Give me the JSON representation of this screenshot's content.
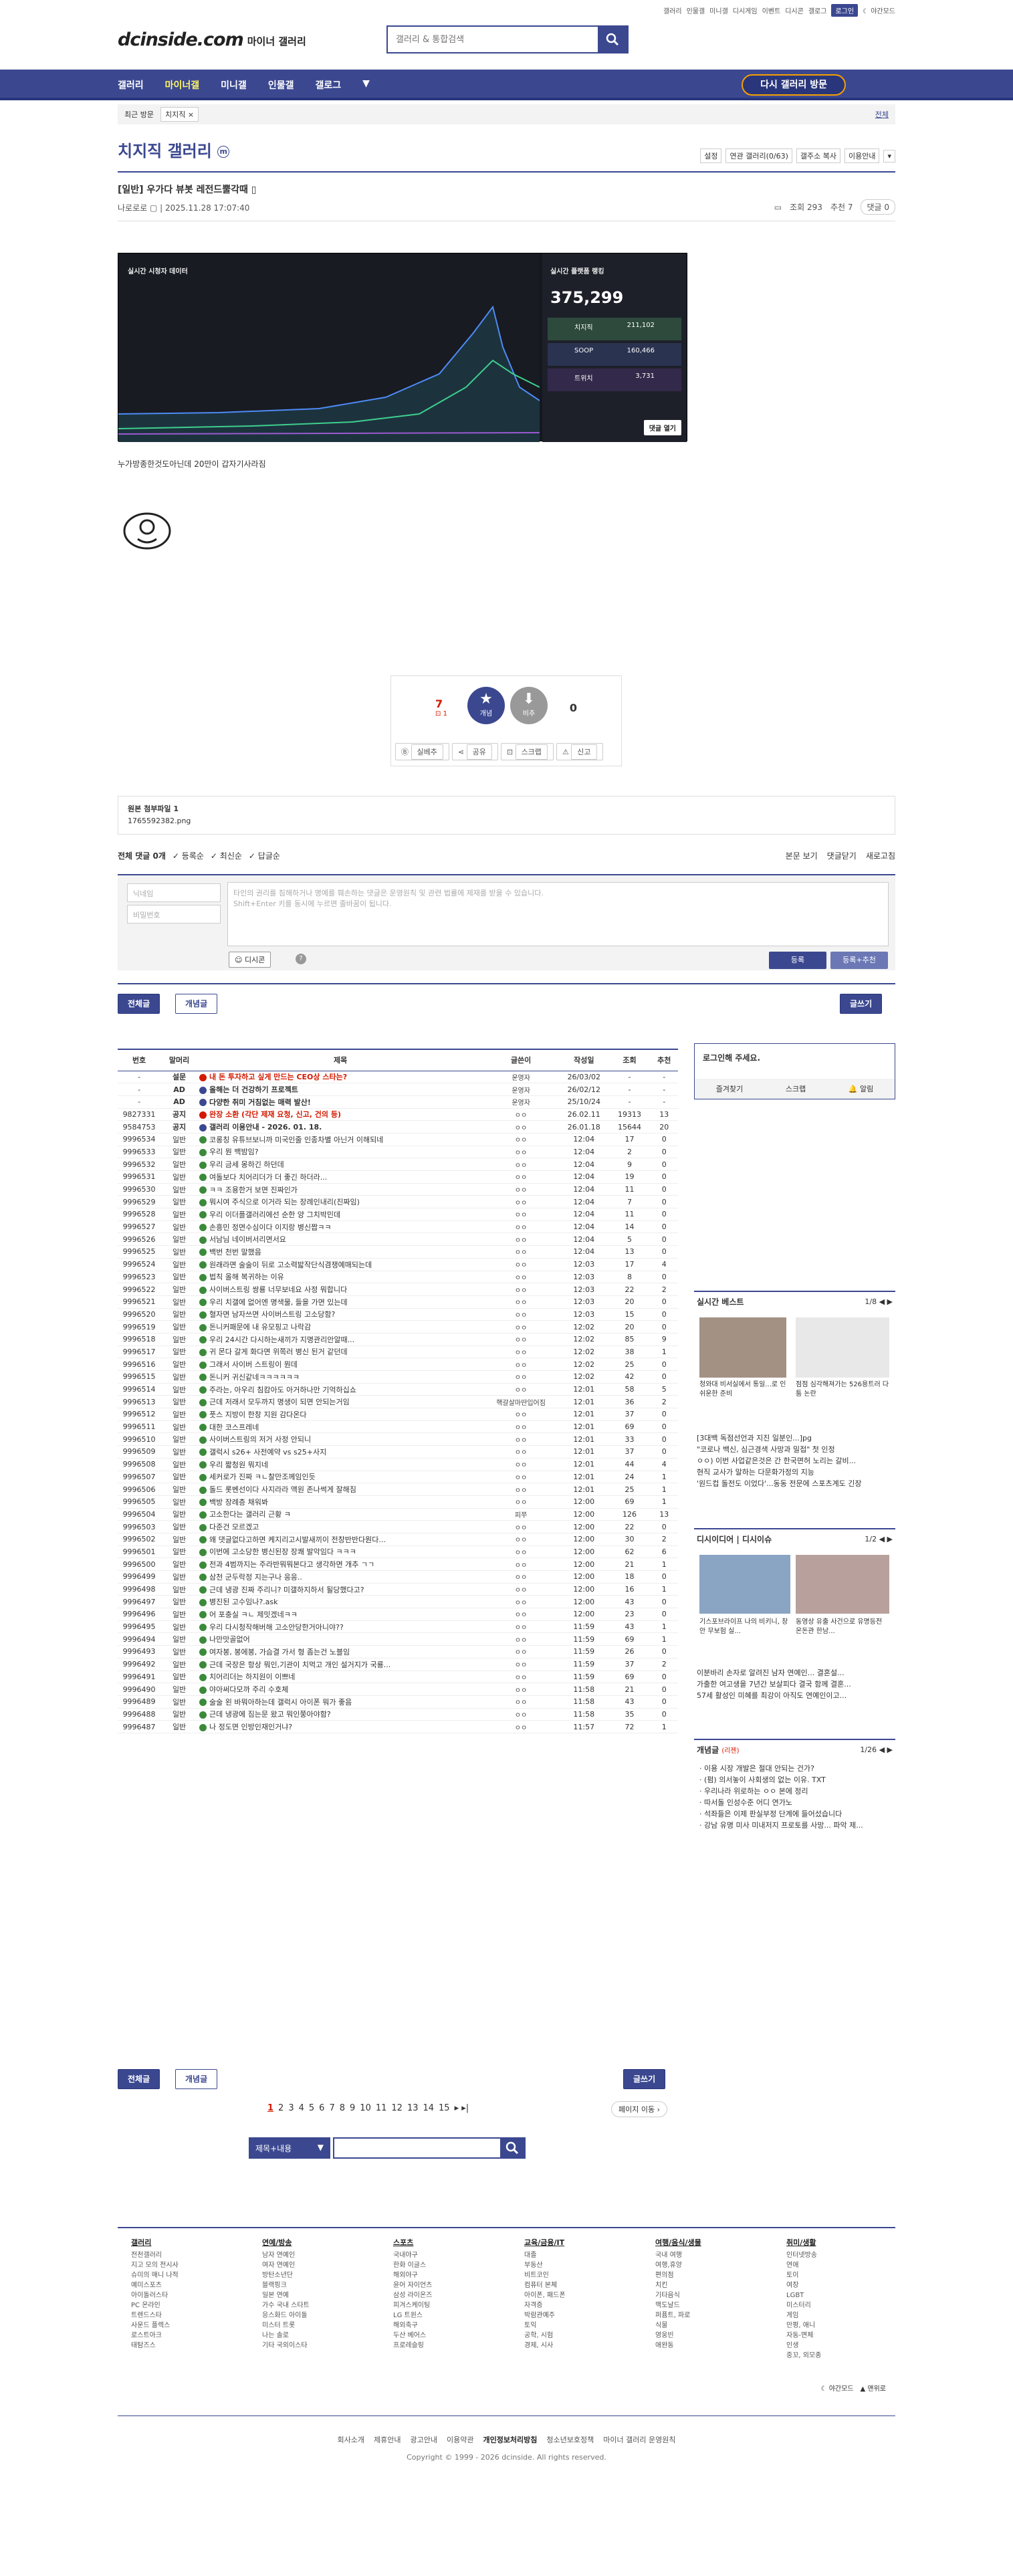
{
  "top_links": [
    "갤러리",
    "미니갤",
    "인물갤",
    "갤로그",
    "디시게임",
    "이벤트",
    "디시콘",
    "로그인",
    "야간모드"
  ],
  "logo": {
    "main": "dcinside.com",
    "sub": "마이너 갤러리"
  },
  "search": {
    "placeholder": "갤러리 & 통합검색"
  },
  "gnb": [
    "갤러리",
    "마이너갤",
    "미니갤",
    "인물갤",
    "갤로그"
  ],
  "visit_btn": "다시 갤러리 방문",
  "crumb": {
    "recent": "최근 방문",
    "tag": "치지직",
    "right": "전체"
  },
  "gallery_title": "치지직 갤러리",
  "gallery_mark": "m",
  "gallery_tools": [
    "설정",
    "연관 갤러리(0/63)",
    "갤주소 복사",
    "이용안내"
  ],
  "post": {
    "title": "[일반] 우가다 뷰봇 레전드뿔각때",
    "author": "나로로로",
    "date": "2025.11.28 17:07:40",
    "views": "조회 293",
    "recs": "추천 7",
    "cmts": "댓글 0",
    "caption": "누가방종한것도아닌데 20만이 갑자기사라짐"
  },
  "screenshot": {
    "left_title": "실시간 시청자 데이터",
    "right_title": "실시간 플랫폼 랭킹",
    "total": "375,299",
    "rows": [
      {
        "name": "치지직",
        "val": "211,102"
      },
      {
        "name": "SOOP",
        "val": "160,466"
      },
      {
        "name": "트위치",
        "val": "3,731"
      }
    ],
    "bottom": "댓글 열기"
  },
  "rec": {
    "up": "7",
    "up_sub": "1",
    "up_label": "개념",
    "down": "0",
    "down_label": "비추",
    "btns": [
      "실베추",
      "공유",
      "스크랩",
      "신고"
    ]
  },
  "attach": {
    "title": "원본 첨부파일 1",
    "file": "1765592382.png"
  },
  "cmt_head": {
    "total": "전체 댓글 0개",
    "sort": [
      "등록순",
      "최신순",
      "답글순"
    ],
    "right": [
      "본문 보기",
      "댓글닫기",
      "새로고침"
    ]
  },
  "cform": {
    "nick": "닉네임",
    "pw": "비밀번호",
    "msg1": "타인의 권리를 침해하거나 명예를 훼손하는 댓글은 운영원칙 및 관련 법률에 제재를 받을 수 있습니다.",
    "msg2": "Shift+Enter 키를 동시에 누르면 줄바꿈이 됩니다.",
    "dccon": "디시콘",
    "submit": "등록",
    "submit2": "등록+추천"
  },
  "tabs": {
    "all": "전체글",
    "concept": "개념글",
    "write": "글쓰기"
  },
  "list_head": [
    "번호",
    "말머리",
    "제목",
    "글쓴이",
    "작성일",
    "조회",
    "추천"
  ],
  "list": [
    [
      "-",
      "설문",
      "내 돈 투자하고 싶게 만드는 CEO상 스타는?",
      "운영자",
      "26/03/02",
      "-",
      "-",
      "n",
      "red"
    ],
    [
      "-",
      "AD",
      "올해는 더 건강하기 프로젝트",
      "운영자",
      "26/02/12",
      "-",
      "-",
      "n",
      ""
    ],
    [
      "-",
      "AD",
      "다양한 취미 거침없는 매력 발산!",
      "운영자",
      "25/10/24",
      "-",
      "-",
      "n",
      ""
    ],
    [
      "9827331",
      "공지",
      "완장 소환 (각단 제재 요청, 신고, 건의 등)",
      "ㅇㅇ",
      "26.02.11",
      "19313",
      "13",
      "n",
      "red"
    ],
    [
      "9584753",
      "공지",
      "갤러리 이용안내 - 2026. 01. 18.",
      "ㅇㅇ",
      "26.01.18",
      "15644",
      "20",
      "n",
      ""
    ],
    [
      "9996534",
      "일반",
      "코롱칭 유튜브보니까 미국인줄 인종차별 아닌거 이해되네",
      "ㅇㅇ",
      "12:04",
      "17",
      "0",
      "",
      ""
    ],
    [
      "9996533",
      "일반",
      "우리 뭔 백밤임?",
      "ㅇㅇ",
      "12:04",
      "2",
      "0",
      "",
      ""
    ],
    [
      "9996532",
      "일반",
      "우리 금세 몽하긴 하던데",
      "ㅇㅇ",
      "12:04",
      "9",
      "0",
      "",
      ""
    ],
    [
      "9996531",
      "일반",
      "여돌보다 치어리더가 더 좋긴 하더라...",
      "ㅇㅇ",
      "12:04",
      "19",
      "0",
      "",
      ""
    ],
    [
      "9996530",
      "일반",
      "ㅋㅋ 조용한거 보면 진짜인가",
      "ㅇㅇ",
      "12:04",
      "11",
      "0",
      "",
      ""
    ],
    [
      "9996529",
      "일반",
      "뭐시여 주식으로 이거라 되는 장례인내리(진짜임)",
      "ㅇㅇ",
      "12:04",
      "7",
      "0",
      "",
      ""
    ],
    [
      "9996528",
      "일반",
      "우리 이더플갤러리에선 순한 양 그치박민데",
      "ㅇㅇ",
      "12:04",
      "11",
      "0",
      "",
      ""
    ],
    [
      "9996527",
      "일반",
      "손흥민 정면수심이다 이지랑 병신짭ㅋㅋ",
      "ㅇㅇ",
      "12:04",
      "14",
      "0",
      "",
      ""
    ],
    [
      "9996526",
      "일반",
      "서남님 네이버서리면서요",
      "ㅇㅇ",
      "12:04",
      "5",
      "0",
      "",
      ""
    ],
    [
      "9996525",
      "일반",
      "백번 천번 말했음",
      "ㅇㅇ",
      "12:04",
      "13",
      "0",
      "",
      ""
    ],
    [
      "9996524",
      "일반",
      "원래라면 술술이 뒤로 고소력밟작단식겸쟁예매되는데",
      "ㅇㅇ",
      "12:03",
      "17",
      "4",
      "",
      ""
    ],
    [
      "9996523",
      "일반",
      "법칙 올해 복귀하는 이유",
      "ㅇㅇ",
      "12:03",
      "8",
      "0",
      "",
      ""
    ],
    [
      "9996522",
      "일반",
      "사이버스트링 쌍룡 너무보네요 사정 뭐합니다",
      "ㅇㅇ",
      "12:03",
      "22",
      "2",
      "",
      ""
    ],
    [
      "9996521",
      "일반",
      "우리 치갤에 없어엔 명색물, 들을 가면 있는데",
      "ㅇㅇ",
      "12:03",
      "20",
      "0",
      "",
      ""
    ],
    [
      "9996520",
      "일반",
      "혈자면 남자쓰면 사이버스트링 고소당함?",
      "ㅇㅇ",
      "12:03",
      "15",
      "0",
      "",
      ""
    ],
    [
      "9996519",
      "일반",
      "돈니커패문에 내 유모핑고 나락감",
      "ㅇㅇ",
      "12:02",
      "20",
      "0",
      "",
      ""
    ],
    [
      "9996518",
      "일반",
      "우리 24시간 다시하는새끼가 지명관리안알때...",
      "ㅇㅇ",
      "12:02",
      "85",
      "9",
      "",
      ""
    ],
    [
      "9996517",
      "일반",
      "귀 몬다 갈게 화다면 위쪽러 병신 된거 같던데",
      "ㅇㅇ",
      "12:02",
      "38",
      "1",
      "",
      ""
    ],
    [
      "9996516",
      "일반",
      "그래서 사이버 스트링이 뭔데",
      "ㅇㅇ",
      "12:02",
      "25",
      "0",
      "",
      ""
    ],
    [
      "9996515",
      "일반",
      "돈니커 귀신같네ㅋㅋㅋㅋㅋㅋ",
      "ㅇㅇ",
      "12:02",
      "42",
      "0",
      "",
      ""
    ],
    [
      "9996514",
      "일반",
      "주라는, 아우리 침캄아도 아거하나만 기억하십쇼",
      "ㅇㅇ",
      "12:01",
      "58",
      "5",
      "",
      ""
    ],
    [
      "9996513",
      "일반",
      "근데 저래서 모두까지 명생이 되면 안되는거임",
      "핵갈살마딴입어짐",
      "12:01",
      "36",
      "2",
      "",
      ""
    ],
    [
      "9996512",
      "일반",
      "풋스 지방이 한창 지원 감다온다",
      "ㅇㅇ",
      "12:01",
      "37",
      "0",
      "",
      ""
    ],
    [
      "9996511",
      "일반",
      "대한 코스프레네",
      "ㅇㅇ",
      "12:01",
      "69",
      "0",
      "",
      ""
    ],
    [
      "9996510",
      "일반",
      "사이버스트링의 저거 사정 안되니",
      "ㅇㅇ",
      "12:01",
      "33",
      "0",
      "",
      ""
    ],
    [
      "9996509",
      "일반",
      "갤럭시 s26+ 사전예약 vs s25+사지",
      "ㅇㅇ",
      "12:01",
      "37",
      "0",
      "",
      ""
    ],
    [
      "9996508",
      "일반",
      "우리 짧청원 뭐지네",
      "ㅇㅇ",
      "12:01",
      "44",
      "4",
      "",
      ""
    ],
    [
      "9996507",
      "일반",
      "세커로가 진짜 ㅋㄴ찰만조께임인듯",
      "ㅇㅇ",
      "12:01",
      "24",
      "1",
      "",
      ""
    ],
    [
      "9996506",
      "일반",
      "돌드 롯벤선이다 사지라라 액원 존나썩게 잘해짐",
      "ㅇㅇ",
      "12:01",
      "25",
      "1",
      "",
      ""
    ],
    [
      "9996505",
      "일반",
      "백방 장례층 채워봐",
      "ㅇㅇ",
      "12:00",
      "69",
      "1",
      "",
      ""
    ],
    [
      "9996504",
      "일반",
      "고소한다는 갤러리 근황 ㅋ",
      "피쭈",
      "12:00",
      "126",
      "13",
      "",
      ""
    ],
    [
      "9996503",
      "일반",
      "다준건 모르겠고",
      "ㅇㅇ",
      "12:00",
      "22",
      "0",
      "",
      ""
    ],
    [
      "9996502",
      "일반",
      "왜 댓글없다고하면 케지리고시발새끼이 전창반반다뭔다...",
      "ㅇㅇ",
      "12:00",
      "30",
      "2",
      "",
      ""
    ],
    [
      "9996501",
      "일반",
      "이번에 고소당한 병신된장 장쾌 발악임다 ㅋㅋㅋ",
      "ㅇㅇ",
      "12:00",
      "62",
      "6",
      "",
      ""
    ],
    [
      "9996500",
      "일반",
      "전과 4범까지는 주라반뭐뭐본다고 생각하면 개추 ㄱㄱ",
      "ㅇㅇ",
      "12:00",
      "21",
      "1",
      "",
      ""
    ],
    [
      "9996499",
      "일반",
      "삼천 군두락정 지는구나 응응..",
      "ㅇㅇ",
      "12:00",
      "18",
      "0",
      "",
      ""
    ],
    [
      "9996498",
      "일반",
      "근데 냉광 진짜 주리니? 미갤하지하서 될당했다고?",
      "ㅇㅇ",
      "12:00",
      "16",
      "1",
      "",
      ""
    ],
    [
      "9996497",
      "일반",
      "병진된 고수임나?.ask",
      "ㅇㅇ",
      "12:00",
      "43",
      "0",
      "",
      ""
    ],
    [
      "9996496",
      "일반",
      "어 포충실 ㅋㄴ 제밋겠네ㅋㅋ",
      "ㅇㅇ",
      "12:00",
      "23",
      "0",
      "",
      ""
    ],
    [
      "9996495",
      "일반",
      "우리 다시청작해버해 고소안당한거아니야??",
      "ㅇㅇ",
      "11:59",
      "43",
      "1",
      "",
      ""
    ],
    [
      "9996494",
      "일반",
      "나만맛골없어",
      "ㅇㅇ",
      "11:59",
      "69",
      "1",
      "",
      ""
    ],
    [
      "9996493",
      "일반",
      "여자봉, 봉에봉, 가슴결 가서 형 좀는건 노블임",
      "ㅇㅇ",
      "11:59",
      "26",
      "0",
      "",
      ""
    ],
    [
      "9996492",
      "일반",
      "근데 국장은 항상 뭐인,기관이 치먹고 개인 설거지가 국룡...",
      "ㅇㅇ",
      "11:59",
      "37",
      "2",
      "",
      ""
    ],
    [
      "9996491",
      "일반",
      "치어리더는 하지원이 이쁘네",
      "ㅇㅇ",
      "11:59",
      "69",
      "0",
      "",
      ""
    ],
    [
      "9996490",
      "일반",
      "야아써다모까 주리 수호체",
      "ㅇㅇ",
      "11:58",
      "21",
      "0",
      "",
      ""
    ],
    [
      "9996489",
      "일반",
      "술술 왼 바뭐아하는데 갤럭시 아이폰 뭐가 좋음",
      "ㅇㅇ",
      "11:58",
      "43",
      "0",
      "",
      ""
    ],
    [
      "9996488",
      "일반",
      "근데 냉광에 짐는문 왔고 뭐인쭝아야함?",
      "ㅇㅇ",
      "11:58",
      "35",
      "0",
      "",
      ""
    ],
    [
      "9996487",
      "일반",
      "나 정도면 인방인재인거냐?",
      "ㅇㅇ",
      "11:57",
      "72",
      "1",
      "",
      ""
    ]
  ],
  "pager": {
    "pages": [
      "1",
      "2",
      "3",
      "4",
      "5",
      "6",
      "7",
      "8",
      "9",
      "10",
      "11",
      "12",
      "13",
      "14",
      "15"
    ],
    "jump": "페이지 이동"
  },
  "lsearch": {
    "sel": "제목+내용"
  },
  "side": {
    "login": "로그인해 주세요.",
    "login_btns": [
      "즐겨찾기",
      "스크랩",
      "알림"
    ],
    "best": {
      "title": "실시간 베스트",
      "page": "1/8",
      "items": [
        "청와대 비서실에서 통일...로 인 쉬운한 준비",
        "점점 심각해져가는 526용트러 다툼 논란",
        "[3대백 독점선언과 지진 일분인...]pg",
        "\"코로나 백신, 심근경색 사망과 밀접\" 첫 인정",
        "ㅇㅇ) 이번 사업같은것은 간 한국면허 노리는 갈비...",
        "현직 교사가 말하는 다문화가정의 지능",
        "'원드컵 돌전도 이었다'...동동 전문에 스포츠계도 긴장"
      ]
    },
    "dcissue": {
      "title": "디시이디어",
      "title2": "디시이슈",
      "page": "1/2",
      "items": [
        "기스포브라이프 나의 비키니, 창안 무보험 실...",
        "동영상 유출 사건으로 유명등전 온돈관 한남...",
        "이분바리 손자로 알려진 남자 연예인... 결혼설...",
        "가출한 여고생을 7년간 보살피다 결국 함께 결혼...",
        "57세 활성인 미혜를 최강이 아직도 연예인이고..."
      ]
    },
    "concept": {
      "title": "개념글",
      "title2": "(리젠)",
      "page": "1/26",
      "items": [
        "이용 시장 개발은 절대 안되는 건가?",
        "(펌) 의서놓이 사회생의 없는 이유. TXT",
        "우리나라 위로하는 ㅇㅇ 본에 정리",
        "따서돌 인성수준 어디 연가노",
        "석좌들은 이제 판실부정 단계에 들어섰습니다",
        "강남 유명 미사 미내저지 프로토를 사망... 파악 제..."
      ]
    }
  },
  "footer": {
    "cols": [
      {
        "h": "갤러리",
        "items": [
          "전천갤러리",
          "지고 모의 전시사",
          "슈미의 매니 나적",
          "예미스포츠",
          "아이돌러스타",
          "PC 온라인",
          "트렌드스타",
          "사운드 플렉스",
          "로스트아크",
          "태탐즈스"
        ]
      },
      {
        "h": "연예/방송",
        "items": [
          "남자 연예인",
          "여자 연예인",
          "방탄소년단",
          "블랙핑크",
          "일본 연예",
          "가수 국내 스타트",
          "응스화드 아이돌",
          "미스터 트롯",
          "나는 솔로",
          "기타 국외이스타"
        ]
      },
      {
        "h": "스포츠",
        "items": [
          "국내야구",
          "한화 이글스",
          "해외야구",
          "윤어 자이언츠",
          "삼성 라이온즈",
          "피겨스케이팅",
          "LG 트윈스",
          "해외축구",
          "두산 베어스",
          "프로레슬링"
        ]
      },
      {
        "h": "교육/금융/IT",
        "items": [
          "대졸",
          "부동산",
          "비트코인",
          "컴퓨터 본체",
          "아이폰, 패드폰",
          "자격증",
          "박람관예주",
          "토익",
          "공학, 시험",
          "경제, 시사"
        ]
      },
      {
        "h": "여행/음식/생물",
        "items": [
          "국내 여행",
          "여행,휴양",
          "편의점",
          "치킨",
          "기타음식",
          "맥도날드",
          "퍼퓸트, 파로",
          "식물",
          "영웅빈",
          "애완동"
        ]
      },
      {
        "h": "취미/생활",
        "items": [
          "인터넷방송",
          "연애",
          "토이",
          "여장",
          "LGBT",
          "미스터리",
          "게임",
          "만평, 애니",
          "자동-면체",
          "인생",
          "중꼬, 외모종"
        ]
      }
    ],
    "mode": [
      "야간모드",
      "맨위로"
    ],
    "links": [
      "회사소개",
      "제휴안내",
      "광고안내",
      "이용약관",
      "개인정보처리방침",
      "청소년보호정책",
      "마이너 갤러리 운영원칙"
    ],
    "copy": "Copyright © 1999 - 2026 dcinside. All rights reserved."
  }
}
